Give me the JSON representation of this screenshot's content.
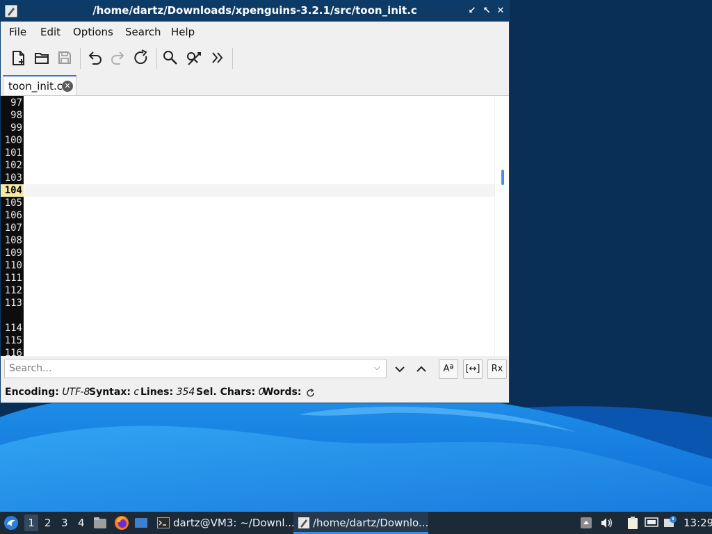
{
  "window": {
    "title": "/home/dartz/Downloads/xpenguins-3.2.1/src/toon_init.c",
    "controls": {
      "minimize": "⭩",
      "maximize": "⭦",
      "close": "✕"
    }
  },
  "menubar": [
    "File",
    "Edit",
    "Options",
    "Search",
    "Help"
  ],
  "toolbar": [
    "new-file",
    "open-file",
    "save-file",
    "undo",
    "redo",
    "reload",
    "find",
    "find-replace",
    "more"
  ],
  "tab": {
    "label": "toon_init.c"
  },
  "editor": {
    "current_line": "104",
    "line_numbers": [
      "97",
      "98",
      "99",
      "100",
      "101",
      "102",
      "103",
      "104",
      "105",
      "106",
      "107",
      "108",
      "109",
      "110",
      "111",
      "112",
      "113",
      "",
      "114",
      "115",
      "116"
    ]
  },
  "search": {
    "placeholder": "Search..."
  },
  "search_options": {
    "case": "Aª",
    "whole_word": "[↔]",
    "regex": "Rx"
  },
  "status": {
    "encoding_label": "Encoding:",
    "encoding_value": "UTF-8",
    "syntax_label": "Syntax:",
    "syntax_value": "c",
    "lines_label": "Lines:",
    "lines_value": "354",
    "sel_label": "Sel. Chars:",
    "sel_value": "0",
    "words_label": "Words:"
  },
  "taskbar": {
    "workspaces": [
      "1",
      "2",
      "3",
      "4"
    ],
    "active_workspace": "1",
    "tasks": [
      {
        "label": "dartz@VM3: ~/Downl...",
        "icon": "terminal-icon"
      },
      {
        "label": "/home/dartz/Downlo...",
        "icon": "text-editor-icon",
        "active": true
      }
    ],
    "clock": "13:29"
  },
  "colors": {
    "titlebar": "#0d3b66",
    "taskbar": "#1c2a38",
    "desktop": "#0a2f56",
    "accent": "#3a8ee6",
    "comment": "#d4141a",
    "string": "#146b14",
    "keyword": "#0b2c78"
  }
}
